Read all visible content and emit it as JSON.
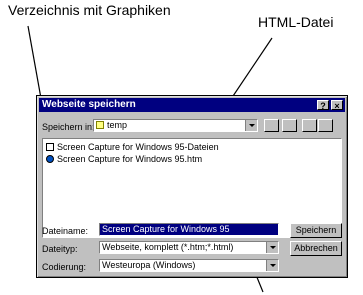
{
  "annotations": {
    "folder_label": "Verzeichnis mit Graphiken",
    "html_label": "HTML-Datei"
  },
  "dialog": {
    "title": "Webseite speichern",
    "help_btn": "?",
    "close_btn": "×",
    "save_in_label": "Speichern in:",
    "save_in_value": "temp",
    "files": [
      {
        "name": "Screen Capture for Windows 95-Dateien",
        "icon": "folder-icon"
      },
      {
        "name": "Screen Capture for Windows 95.htm",
        "icon": "ie-document-icon"
      }
    ],
    "filename_label": "Dateiname:",
    "filename_value": "Screen Capture for Windows 95",
    "filetype_label": "Dateityp:",
    "filetype_value": "Webseite, komplett (*.htm;*.html)",
    "encoding_label": "Codierung:",
    "encoding_value": "Westeuropa (Windows)",
    "save_button": "Speichern",
    "cancel_button": "Abbrechen"
  }
}
